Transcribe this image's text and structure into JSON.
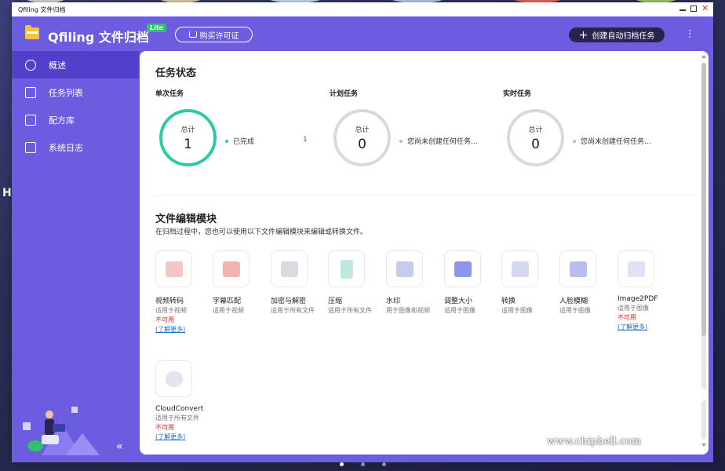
{
  "window": {
    "title": "Qfiling 文件归档"
  },
  "appbar": {
    "title": "Qfiling 文件归档",
    "badge": "Lite",
    "buy_label": "购买许可证",
    "create_label": "创建自动归档任务"
  },
  "sidebar": {
    "items": [
      {
        "label": "概述",
        "icon": "dashboard-icon",
        "active": true
      },
      {
        "label": "任务列表",
        "icon": "task-list-icon",
        "active": false
      },
      {
        "label": "配方库",
        "icon": "recipe-icon",
        "active": false
      },
      {
        "label": "系统日志",
        "icon": "log-icon",
        "active": false
      }
    ]
  },
  "task_status": {
    "title": "任务状态",
    "columns": [
      {
        "label": "单次任务",
        "ring_label": "总计",
        "total": "1",
        "legend": "已完成",
        "legend_count": "1"
      },
      {
        "label": "计划任务",
        "ring_label": "总计",
        "total": "0",
        "legend": "您尚未创建任何任务..."
      },
      {
        "label": "实时任务",
        "ring_label": "总计",
        "total": "0",
        "legend": "您尚未创建任何任务..."
      }
    ]
  },
  "modules": {
    "title": "文件编辑模块",
    "subtitle": "在归档过程中，您也可以使用以下文件编辑模块来编辑或转换文件。",
    "items": [
      {
        "name": "视频转码",
        "desc": "适用于视频",
        "na": "不可用",
        "link": "(了解更多)",
        "icon": "video-transcode-icon"
      },
      {
        "name": "字幕匹配",
        "desc": "适用于视频",
        "icon": "subtitle-icon"
      },
      {
        "name": "加密与解密",
        "desc": "适用于所有文件",
        "icon": "encrypt-icon"
      },
      {
        "name": "压缩",
        "desc": "适用于所有文件",
        "icon": "compress-icon"
      },
      {
        "name": "水印",
        "desc": "用于图像和视频",
        "icon": "watermark-icon"
      },
      {
        "name": "调整大小",
        "desc": "适用于图像",
        "icon": "resize-icon"
      },
      {
        "name": "转换",
        "desc": "适用于图像",
        "icon": "convert-icon"
      },
      {
        "name": "人脸模糊",
        "desc": "适用于图像",
        "icon": "face-blur-icon"
      },
      {
        "name": "Image2PDF",
        "desc": "适用于图像",
        "na": "不可用",
        "link": "(了解更多)",
        "icon": "image2pdf-icon"
      },
      {
        "name": "CloudConvert",
        "desc": "适用于所有文件",
        "na": "不可用",
        "link": "(了解更多)",
        "icon": "cloudconvert-icon"
      }
    ]
  },
  "desktop": {
    "letter": "H",
    "watermark": "www.chiphell.com",
    "watermark_logo": "chip hell"
  },
  "colors": {
    "accent": "#6c5ce0",
    "active": "#5140c9",
    "ring_done": "#2ecaa4",
    "error": "#e0281f",
    "link": "#1a6ec8"
  }
}
